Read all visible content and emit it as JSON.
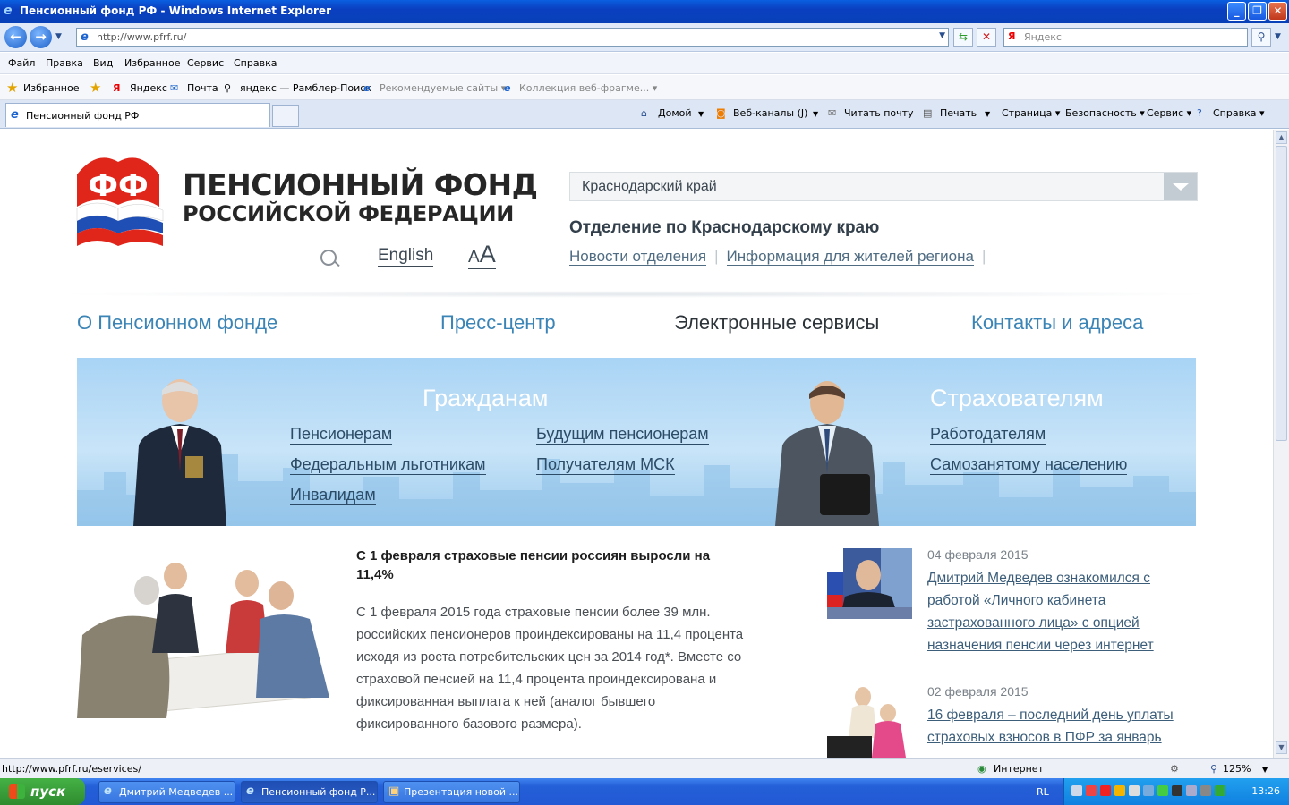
{
  "window": {
    "title": "Пенсионный фонд РФ - Windows Internet Explorer",
    "min": "_",
    "max": "❐",
    "close": "✕"
  },
  "address": {
    "url": "http://www.pfrf.ru/",
    "search_placeholder": "Яндекс"
  },
  "menu": [
    "Файл",
    "Правка",
    "Вид",
    "Избранное",
    "Сервис",
    "Справка"
  ],
  "favorites": {
    "label": "Избранное",
    "items": [
      "Яндекс",
      "Почта",
      "яндекс — Рамблер-Поиск",
      "Рекомендуемые сайты ▾",
      "Коллекция веб-фрагме... ▾"
    ]
  },
  "tab": {
    "title": "Пенсионный фонд РФ"
  },
  "commands": [
    "Домой",
    "Веб-каналы (J)",
    "Читать почту",
    "Печать",
    "Страница ▾",
    "Безопасность ▾",
    "Сервис ▾",
    "Справка ▾"
  ],
  "site": {
    "logo_line1": "ПЕНСИОННЫЙ ФОНД",
    "logo_line2": "РОССИЙСКОЙ ФЕДЕРАЦИИ",
    "english": "English",
    "font_small": "A",
    "font_big": "A",
    "region": "Краснодарский край",
    "branch": "Отделение по Краснодарскому краю",
    "branch_links": [
      "Новости отделения",
      "Информация для жителей региона"
    ],
    "nav": [
      "О Пенсионном фонде",
      "Пресс-центр",
      "Электронные сервисы",
      "Контакты и адреса"
    ],
    "banner": {
      "citizens_title": "Гражданам",
      "citizens_links": [
        "Пенсионерам",
        "Федеральным льготникам",
        "Инвалидам",
        "Будущим пенсионерам",
        "Получателям МСК"
      ],
      "insurers_title": "Страхователям",
      "insurers_links": [
        "Работодателям",
        "Самозанятому населению"
      ]
    },
    "news": {
      "headline": "С 1 февраля страховые пенсии россиян выросли на 11,4%",
      "body": "С 1 февраля 2015 года страховые пенсии более 39 млн. российских пенсионеров проиндексированы на 11,4 процента исходя из роста потребительских цен за 2014 год*. Вместе со страховой пенсией на 11,4 процента проиндексирована и фиксированная выплата к ней (аналог бывшего фиксированного базового размера)."
    },
    "side_news": [
      {
        "date": "04 февраля 2015",
        "title": "Дмитрий Медведев ознакомился с работой «Личного кабинета застрахованного лица» с опцией назначения пенсии через интернет"
      },
      {
        "date": "02 февраля 2015",
        "title": "16 февраля – последний день уплаты страховых взносов в ПФР за январь"
      }
    ]
  },
  "status": {
    "url": "http://www.pfrf.ru/eservices/",
    "zone": "Интернет",
    "zoom": "125%"
  },
  "taskbar": {
    "start": "пуск",
    "buttons": [
      "Дмитрий Медведев ...",
      "Пенсионный фонд Р...",
      "Презентация новой ..."
    ],
    "lang": "RL",
    "clock": "13:26"
  },
  "colors": {
    "link": "#3b84b6",
    "title_bar": "#0a4fd0",
    "banner": "#a9d4f5"
  }
}
